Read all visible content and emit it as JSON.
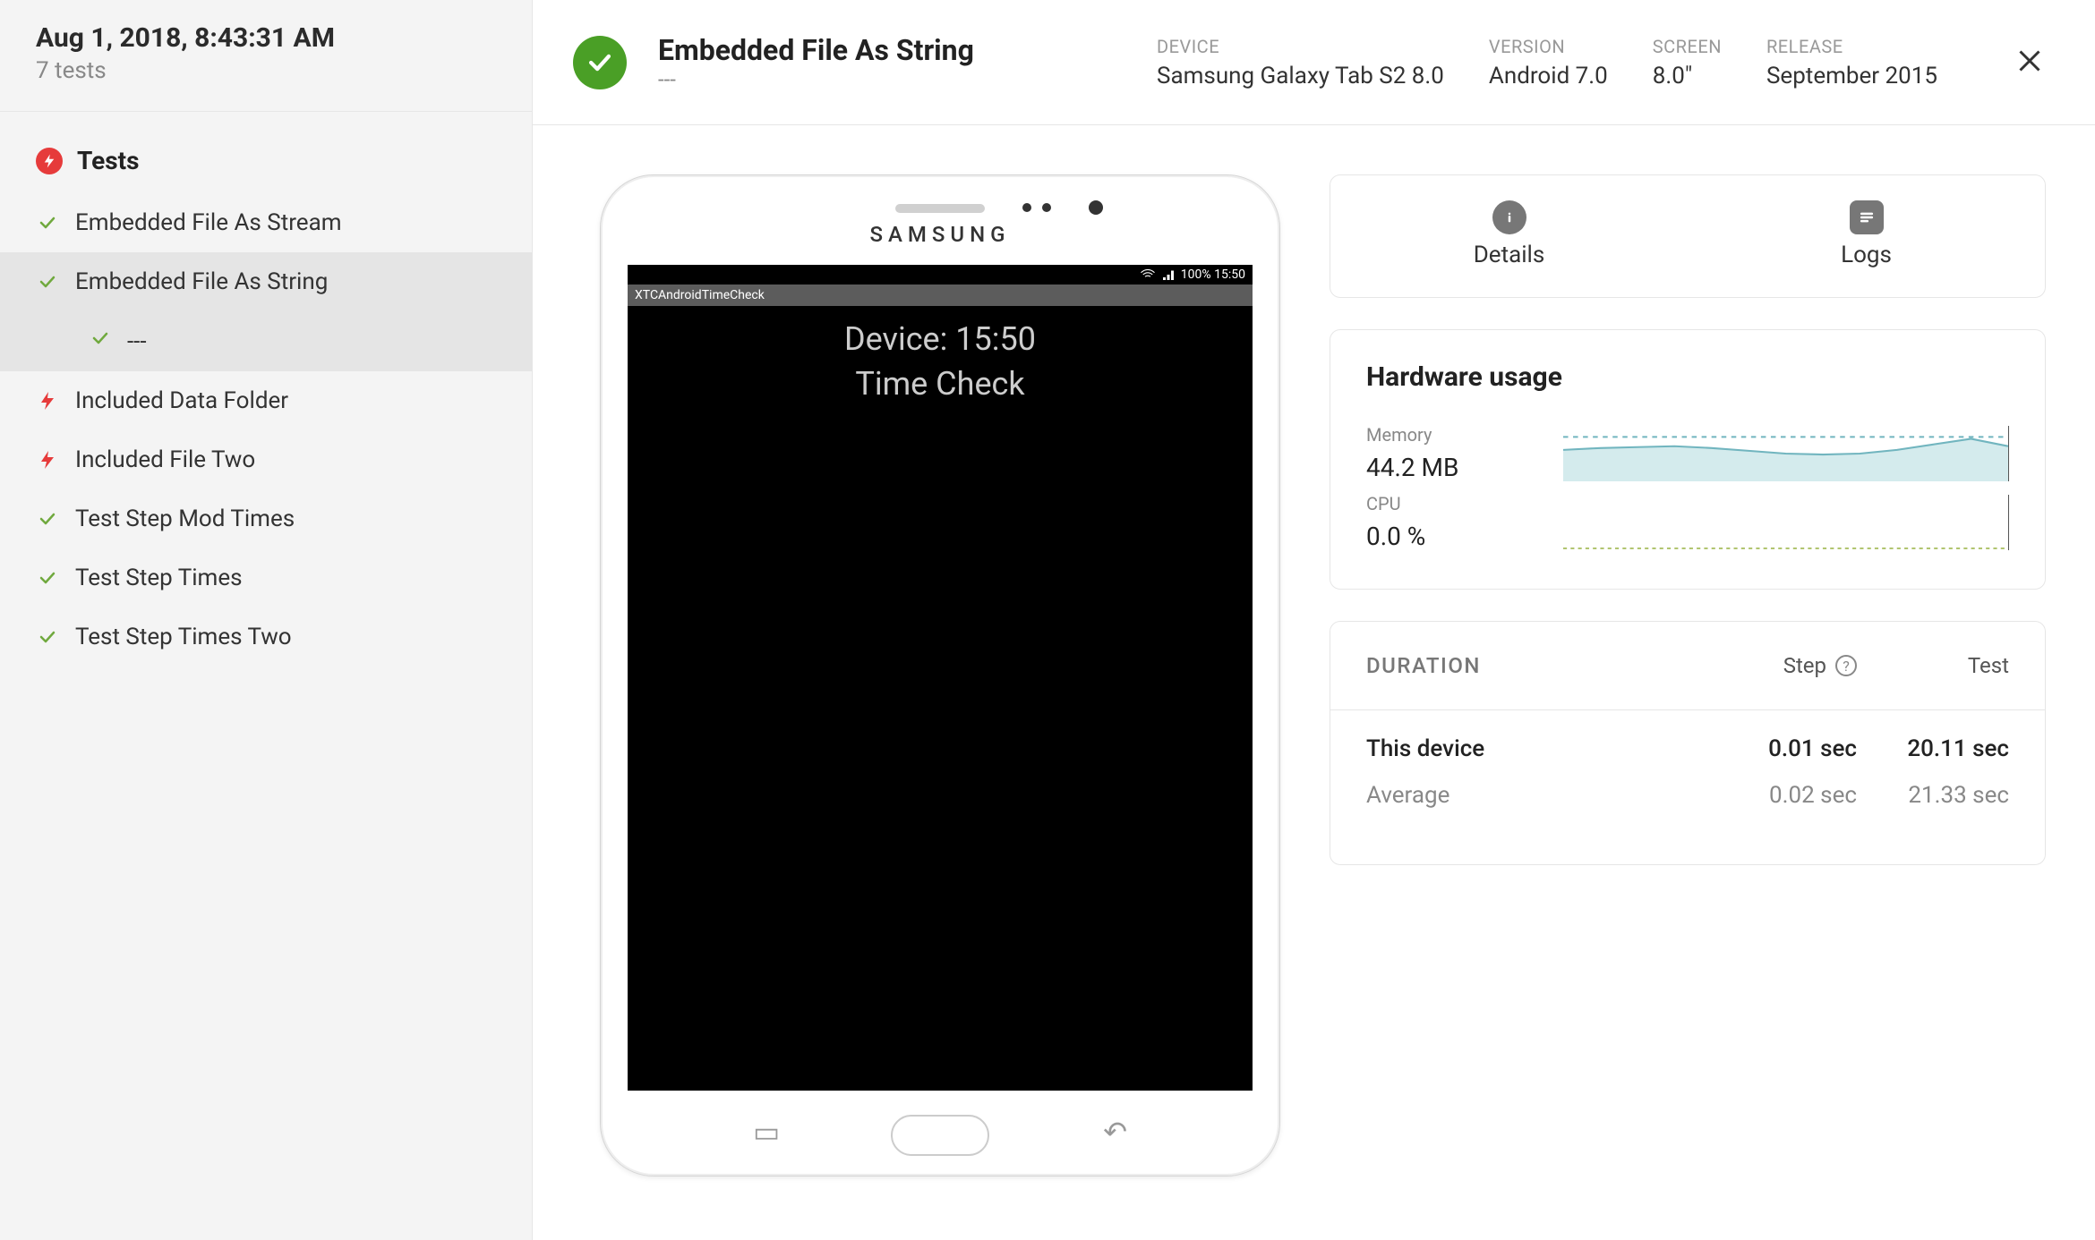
{
  "sidebar": {
    "date": "Aug 1, 2018, 8:43:31 AM",
    "count": "7 tests",
    "heading": "Tests",
    "tests": [
      {
        "label": "Embedded File As Stream",
        "status": "pass"
      },
      {
        "label": "Embedded File As String",
        "status": "pass"
      },
      {
        "label": "Included Data Folder",
        "status": "fail"
      },
      {
        "label": "Included File Two",
        "status": "fail"
      },
      {
        "label": "Test Step Mod Times",
        "status": "pass"
      },
      {
        "label": "Test Step Times",
        "status": "pass"
      },
      {
        "label": "Test Step Times Two",
        "status": "pass"
      }
    ],
    "selected_index": 1,
    "selected_step_label": "---"
  },
  "header": {
    "title": "Embedded File As String",
    "subtitle": "---",
    "meta": [
      {
        "label": "DEVICE",
        "value": "Samsung Galaxy Tab S2 8.0"
      },
      {
        "label": "VERSION",
        "value": "Android 7.0"
      },
      {
        "label": "SCREEN",
        "value": "8.0\""
      },
      {
        "label": "RELEASE",
        "value": "September 2015"
      }
    ]
  },
  "device": {
    "brand": "SAMSUNG",
    "status_bar_text": "100% 15:50",
    "app_bar": "XTCAndroidTimeCheck",
    "line1": "Device: 15:50",
    "line2": "Time Check"
  },
  "tabs": {
    "details": "Details",
    "logs": "Logs"
  },
  "hardware": {
    "title": "Hardware usage",
    "memory_label": "Memory",
    "memory_value": "44.2 MB",
    "cpu_label": "CPU",
    "cpu_value": "0.0 %"
  },
  "duration": {
    "title": "DURATION",
    "col_step": "Step",
    "col_test": "Test",
    "rows": [
      {
        "label": "This device",
        "step": "0.01 sec",
        "test": "20.11 sec",
        "primary": true
      },
      {
        "label": "Average",
        "step": "0.02 sec",
        "test": "21.33 sec",
        "primary": false
      }
    ]
  },
  "chart_data": [
    {
      "type": "area",
      "name": "Memory",
      "unit": "MB",
      "y_current": 44.2,
      "ylim": [
        40,
        48
      ],
      "values": [
        43.5,
        44.0,
        44.2,
        44.3,
        44.1,
        43.8,
        43.6,
        43.5,
        43.6,
        44.0,
        44.6,
        45.2,
        44.2
      ]
    },
    {
      "type": "line",
      "name": "CPU",
      "unit": "%",
      "y_current": 0.0,
      "ylim": [
        0,
        5
      ],
      "values": [
        0.0,
        0.0,
        0.0,
        0.0,
        0.0,
        0.0,
        0.0,
        0.0,
        0.0,
        0.0,
        0.0,
        0.0,
        0.0
      ]
    }
  ]
}
